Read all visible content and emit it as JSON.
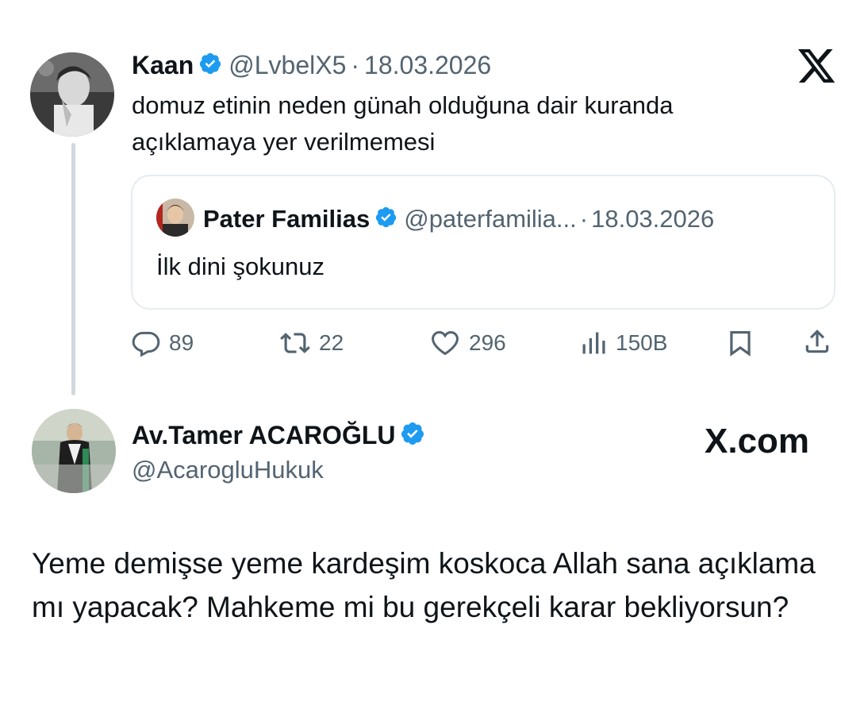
{
  "tweet": {
    "author_name": "Kaan",
    "handle": "@LvbelX5",
    "separator": "·",
    "date": "18.03.2026",
    "text": "domuz etinin neden günah olduğuna dair kuranda açıklamaya yer verilmemesi",
    "verified": true
  },
  "quoted_tweet": {
    "author_name": "Pater Familias",
    "handle": "@paterfamilia...",
    "separator": "·",
    "date": "18.03.2026",
    "text": "İlk dini şokunuz",
    "verified": true
  },
  "actions": {
    "replies": "89",
    "retweets": "22",
    "likes": "296",
    "views": "150B"
  },
  "reply": {
    "author_name": "Av.Tamer ACAROĞLU",
    "handle": "@AcarogluHukuk",
    "watermark": "X.com",
    "text": "Yeme demişse yeme kardeşim koskoca Allah sana açıklama mı yapacak? Mahkeme mi bu gerekçeli karar bekliyorsun?",
    "verified": true
  },
  "icons": {
    "verified_color": "#1d9bf0",
    "brand": "x-logo-icon"
  },
  "colors": {
    "text_primary": "#0f1419",
    "text_secondary": "#536471",
    "verified": "#1d9bf0"
  }
}
